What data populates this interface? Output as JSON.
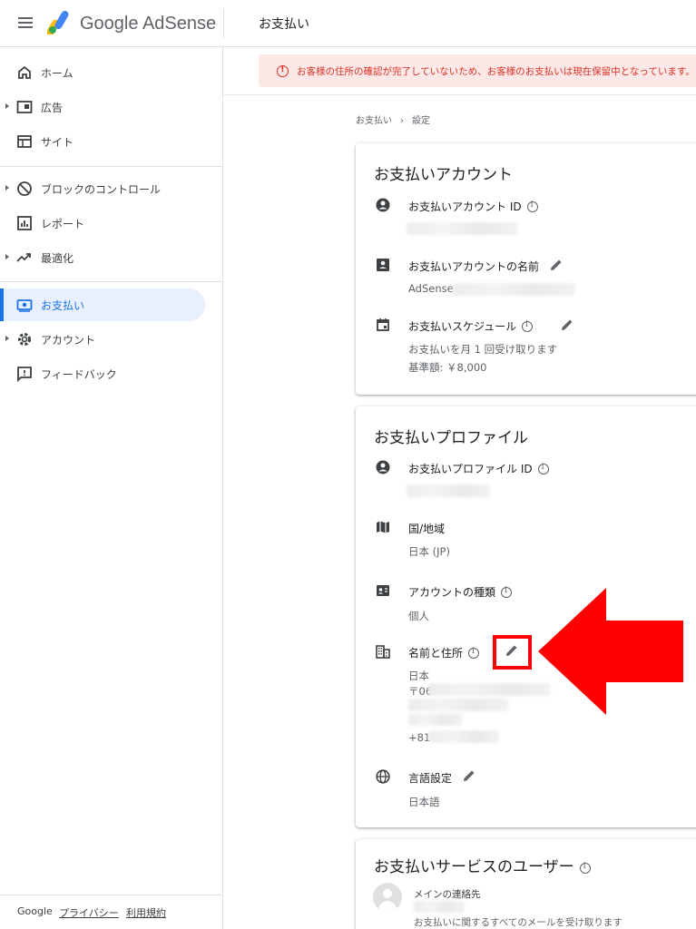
{
  "app": {
    "name": "Google AdSense",
    "page_title": "お支払い"
  },
  "alert": {
    "text": "お客様の住所の確認が完了していないため、お客様のお支払いは現在保留中となっています。"
  },
  "breadcrumb": {
    "items": [
      "お支払い",
      "設定"
    ],
    "separator": "›"
  },
  "sidebar": {
    "items": [
      {
        "label": "ホーム",
        "icon": "home-icon"
      },
      {
        "label": "広告",
        "icon": "ads-icon"
      },
      {
        "label": "サイト",
        "icon": "sites-icon"
      },
      {
        "label": "ブロックのコントロール",
        "icon": "block-icon"
      },
      {
        "label": "レポート",
        "icon": "report-icon"
      },
      {
        "label": "最適化",
        "icon": "trending-icon"
      },
      {
        "label": "お支払い",
        "icon": "payments-icon"
      },
      {
        "label": "アカウント",
        "icon": "gear-icon"
      },
      {
        "label": "フィードバック",
        "icon": "feedback-icon"
      }
    ],
    "active": "お支払い",
    "footer": {
      "brand": "Google",
      "privacy": "プライバシー",
      "terms": "利用規約"
    }
  },
  "payments_account": {
    "title": "お支払いアカウント",
    "id_label": "お支払いアカウント ID",
    "name_label": "お支払いアカウントの名前",
    "name_value_prefix": "AdSense",
    "schedule_label": "お支払いスケジュール",
    "schedule_value": "お支払いを月 1 回受け取ります",
    "threshold_value": "基準額: ￥8,000"
  },
  "payments_profile": {
    "title": "お支払いプロファイル",
    "id_label": "お支払いプロファイル ID",
    "country_label": "国/地域",
    "country_value": "日本 (JP)",
    "account_type_label": "アカウントの種類",
    "account_type_value": "個人",
    "name_address_label": "名前と住所",
    "address_country": "日本",
    "postal_prefix": "〒06",
    "phone_prefix": "+81",
    "language_label": "言語設定",
    "language_value": "日本語"
  },
  "payments_users": {
    "title": "お支払いサービスのユーザー",
    "contact_label": "メインの連絡先",
    "contact_desc": "お支払いに関するすべてのメールを受け取ります"
  },
  "colors": {
    "accent": "#1a73e8",
    "alert": "#d93025",
    "alert_bg": "#fce8e6",
    "annotation": "#ff0000"
  }
}
